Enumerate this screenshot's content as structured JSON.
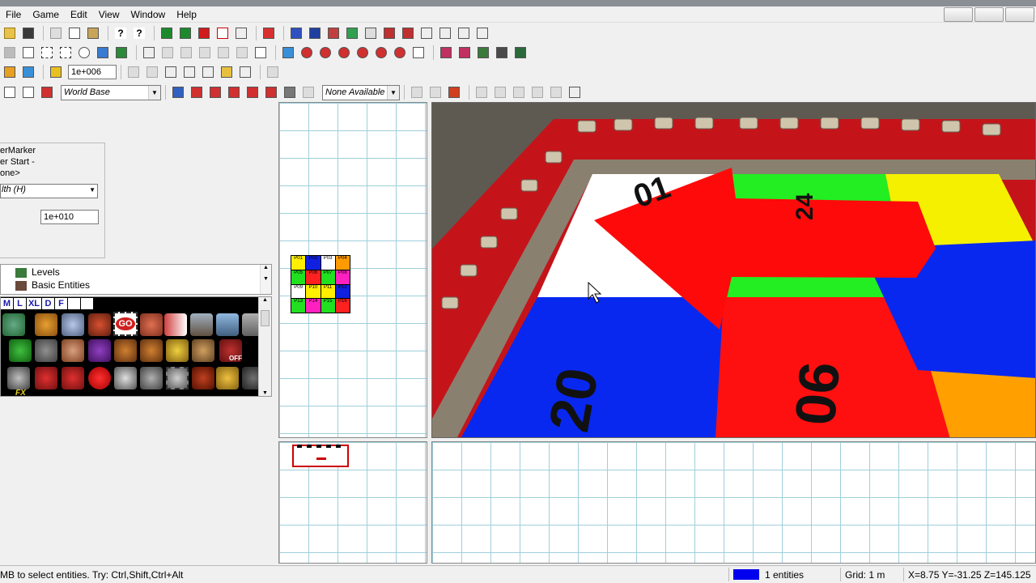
{
  "menu": {
    "file": "File",
    "game": "Game",
    "edit": "Edit",
    "view": "View",
    "window": "Window",
    "help": "Help"
  },
  "toolbar3": {
    "grid_value": "1e+006"
  },
  "toolbar4": {
    "base_combo": "World Base",
    "anim_combo": "None Available"
  },
  "properties": {
    "line1": "erMarker",
    "line2": "er Start -",
    "line3": "one>",
    "combo_value": "lth (H)",
    "value_input": "1e+010"
  },
  "tree": {
    "items": [
      "Levels",
      "Basic Entities"
    ]
  },
  "entity_tabs": [
    "M",
    "L",
    "XL",
    "D",
    "F"
  ],
  "entity_labels": {
    "go": "GO",
    "fx": "FX",
    "off": "OFF"
  },
  "board_tiles": [
    "P01",
    "P02",
    "P03",
    "P04",
    "P05",
    "P06",
    "P07",
    "P08",
    "P09",
    "P10",
    "P11",
    "P12",
    "P13",
    "P14",
    "P15",
    "P16"
  ],
  "scene_numbers": [
    "01",
    "20",
    "06",
    "24"
  ],
  "status": {
    "hint": "MB to select entities. Try: Ctrl,Shift,Ctrl+Alt",
    "color": "#0000ee",
    "entities": "1 entities",
    "grid": "Grid: 1 m",
    "coords": "X=8.75 Y=-31.25 Z=145.125"
  }
}
